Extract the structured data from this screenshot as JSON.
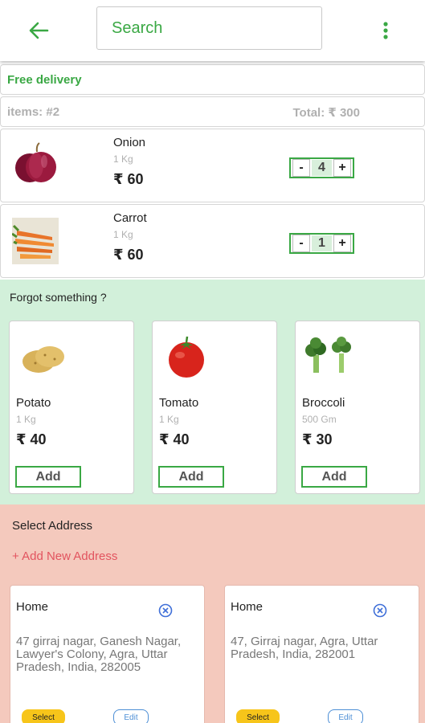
{
  "header": {
    "search_placeholder": "Search",
    "back_icon": "arrow-left-icon",
    "menu_icon": "more-vertical-icon",
    "accent_color": "#3aa844"
  },
  "cart": {
    "free_delivery": "Free delivery",
    "items_label": "items: #2",
    "total_label": "Total: ₹ 300",
    "items": [
      {
        "name": "Onion",
        "unit": "1 Kg",
        "price": "₹ 60",
        "quantity": "4",
        "minus": "-",
        "plus": "+"
      },
      {
        "name": "Carrot",
        "unit": "1 Kg",
        "price": "₹ 60",
        "quantity": "1",
        "minus": "-",
        "plus": "+"
      }
    ]
  },
  "suggestions": {
    "title": "Forgot something ?",
    "background": "#d2f0da",
    "products": [
      {
        "name": "Potato",
        "unit": "1 Kg",
        "price": "₹ 40",
        "add_label": "Add"
      },
      {
        "name": "Tomato",
        "unit": "1 Kg",
        "price": "₹ 40",
        "add_label": "Add"
      },
      {
        "name": "Broccoli",
        "unit": "500 Gm",
        "price": "₹ 30",
        "add_label": "Add"
      }
    ]
  },
  "address": {
    "title": "Select Address",
    "add_new": "+ Add New Address",
    "background": "#f4c9bd",
    "cards": [
      {
        "label": "Home",
        "text": "47 girraj nagar, Ganesh Nagar, Lawyer's Colony, Agra, Uttar Pradesh, India, 282005",
        "select_label": "Select",
        "edit_label": "Edit"
      },
      {
        "label": "Home",
        "text": "47, Girraj nagar, Agra, Uttar Pradesh, India, 282001",
        "select_label": "Select",
        "edit_label": "Edit"
      }
    ]
  }
}
